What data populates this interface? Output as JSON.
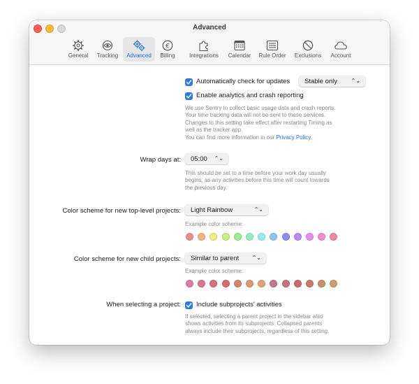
{
  "window": {
    "title": "Advanced"
  },
  "tabs": [
    {
      "label": "General",
      "icon": "gear-icon",
      "active": false
    },
    {
      "label": "Tracking",
      "icon": "eye-icon",
      "active": false
    },
    {
      "label": "Advanced",
      "icon": "gears-icon",
      "active": true
    },
    {
      "label": "Billing",
      "icon": "euro-icon",
      "active": false
    },
    {
      "label": "Integrations",
      "icon": "puzzle-icon",
      "active": false
    },
    {
      "label": "Calendar",
      "icon": "calendar-icon",
      "active": false
    },
    {
      "label": "Rule Order",
      "icon": "list-icon",
      "active": false
    },
    {
      "label": "Exclusions",
      "icon": "prohibited-icon",
      "active": false
    },
    {
      "label": "Account",
      "icon": "cloud-icon",
      "active": false
    }
  ],
  "updates": {
    "check_label": "Automatically check for updates",
    "checked": true,
    "channel": "Stable only"
  },
  "analytics": {
    "label": "Enable analytics and crash reporting",
    "checked": true,
    "desc_lines": [
      "We use Sentry to collect basic usage data and crash reports.",
      "Your time tracking data will not be sent to these services.",
      "Changes to this setting take effect after restarting Timing as",
      "well as the tracker app."
    ],
    "more_info_prefix": "You can find more information in our ",
    "privacy_link": "Privacy Policy",
    "more_info_suffix": "."
  },
  "wrap_days": {
    "label": "Wrap days at:",
    "value": "05:00",
    "desc_lines": [
      "This should be set to a time before your work day usually",
      "begins, as any activities before this time will count towards",
      "the previous day."
    ]
  },
  "top_level_scheme": {
    "label": "Color scheme for new top-level projects:",
    "value": "Light Rainbow",
    "example_label": "Example color scheme:",
    "colors": [
      "#f08a8a",
      "#f3b37e",
      "#f4ec84",
      "#c7ef83",
      "#97ee8e",
      "#94efc0",
      "#93eef0",
      "#8cc5f2",
      "#8a8ef2",
      "#b48cf0",
      "#e78ef0",
      "#ef8ecf",
      "#f08aa0"
    ]
  },
  "child_scheme": {
    "label": "Color scheme for new child projects:",
    "value": "Similar to parent",
    "example_label": "Example color scheme:",
    "colors": [
      "#dd7aa5",
      "#dc7791",
      "#db6f7c",
      "#d96a6a",
      "#d9846a",
      "#d99a72",
      "#dfa57a",
      "#c07592",
      "#c7707f",
      "#c96b6b",
      "#c87a68",
      "#c88f66",
      "#c9a06d"
    ]
  },
  "select_project": {
    "label": "When selecting a project:",
    "checkbox_label": "Include subprojects' activities",
    "checked": true,
    "desc_lines": [
      "If selected, selecting a parent project in the sidebar also",
      "shows activities from its subprojects. Collapsed parents",
      "always include their subprojects, regardless of this setting."
    ]
  },
  "colors": {
    "accent": "#1d6fe8",
    "checkbox": "#2a7ae2"
  }
}
